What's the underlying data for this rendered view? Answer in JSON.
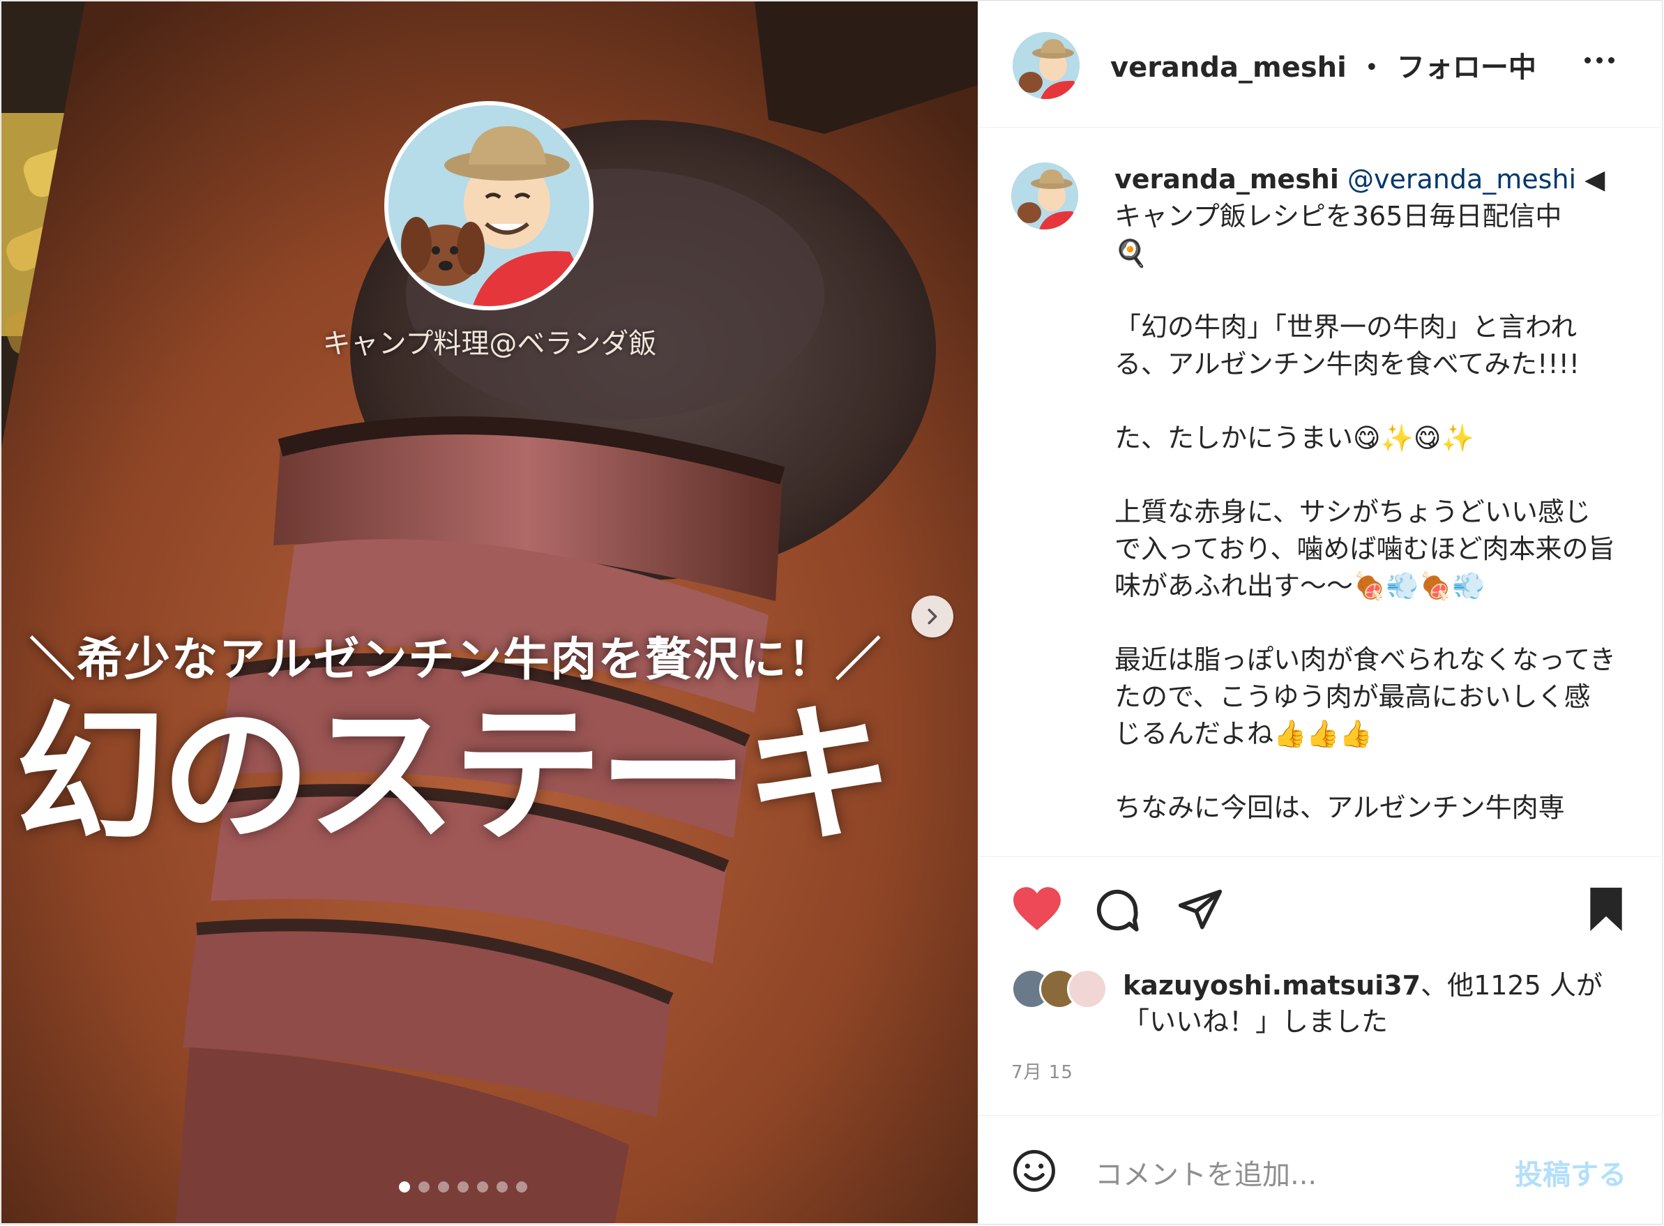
{
  "media": {
    "brand_label": "キャンプ料理@ベランダ飯",
    "subtitle": "＼希少なアルゼンチン牛肉を贅沢に！／",
    "title": "幻のステーキ",
    "carousel_dots": 7,
    "active_dot": 0
  },
  "header": {
    "username": "veranda_meshi",
    "separator": "・",
    "follow_status": "フォロー中"
  },
  "caption": {
    "username": "veranda_meshi",
    "mention": "@veranda_meshi",
    "body": " ◀\nキャンプ飯レシピを365日毎日配信中\n🍳\n\n「幻の牛肉」「世界一の牛肉」と言われる、アルゼンチン牛肉を食べてみた!!!!\n\nた、たしかにうまい😋✨😋✨\n\n上質な赤身に、サシがちょうどいい感じで入っており、噛めば噛むほど肉本来の旨味があふれ出す〜〜🍖💨🍖💨\n\n最近は脂っぽい肉が食べられなくなってきたので、こうゆう肉が最高においしく感じるんだよね👍👍👍\n\nちなみに今回は、アルゼンチン牛肉専"
  },
  "likes": {
    "user": "kazuyoshi.matsui37",
    "rest": "、他1125 人が「いいね！」しました"
  },
  "date": "7月 15",
  "comment": {
    "placeholder": "コメントを追加...",
    "post_label": "投稿する"
  },
  "colors": {
    "like_red": "#ed4956",
    "post_disabled": "#b2dffc",
    "mention": "#00376b"
  }
}
